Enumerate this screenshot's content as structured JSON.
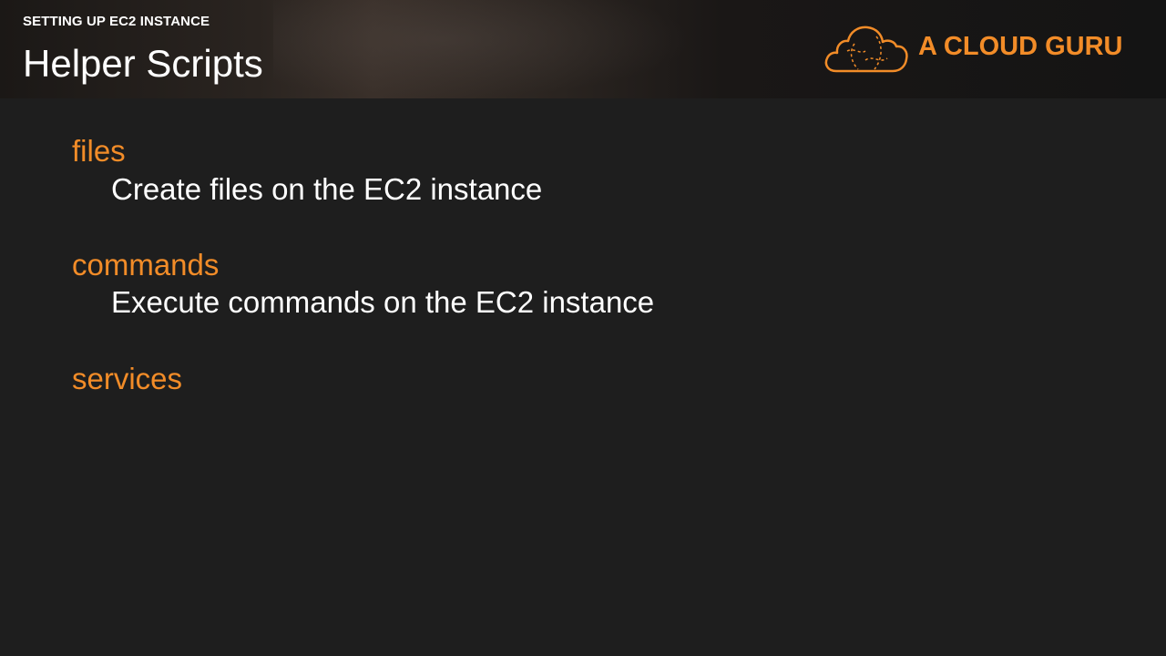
{
  "header": {
    "section_label": "SETTING UP EC2 INSTANCE",
    "title": "Helper Scripts"
  },
  "brand": {
    "name": "A CLOUD GURU",
    "logo_icon": "cloud-logo-icon",
    "accent_color": "#f28c28"
  },
  "items": [
    {
      "term": "files",
      "description": "Create files on the EC2 instance"
    },
    {
      "term": "commands",
      "description": "Execute commands on the EC2 instance"
    },
    {
      "term": "services",
      "description": ""
    }
  ]
}
